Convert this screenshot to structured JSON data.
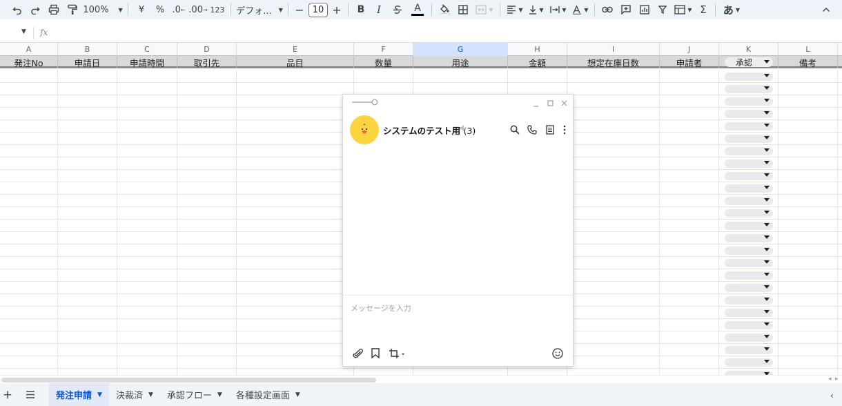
{
  "toolbar": {
    "zoom": "100%",
    "currency": "¥",
    "percent": "%",
    "decimal_decrease": ".0",
    "decimal_increase": ".00",
    "number_format": "123",
    "font_name": "デフォ...",
    "font_size": "10",
    "minus": "−",
    "plus": "+",
    "bold": "B",
    "italic": "I",
    "text_color": "A",
    "input_tools": "あ",
    "sum": "Σ"
  },
  "formula": {
    "fx": "fx"
  },
  "columns": [
    "A",
    "B",
    "C",
    "D",
    "E",
    "F",
    "G",
    "H",
    "I",
    "J",
    "K",
    "L"
  ],
  "headers": [
    "発注No",
    "申請日",
    "申請時間",
    "取引先",
    "品目",
    "数量",
    "用途",
    "金額",
    "想定在庫日数",
    "申請者",
    "承認",
    "備考"
  ],
  "chat": {
    "title": "システムのテスト用",
    "count": "(3)",
    "placeholder": "メッセージを入力"
  },
  "sheets": [
    {
      "label": "発注申請",
      "active": true
    },
    {
      "label": "決裁済",
      "active": false
    },
    {
      "label": "承認フロー",
      "active": false
    },
    {
      "label": "各種設定画面",
      "active": false
    }
  ],
  "colors": {
    "accent": "#0b57d0",
    "toolbar_bg": "#eef2f9",
    "header_fill": "#d9d9d9",
    "avatar": "#fcd440"
  }
}
